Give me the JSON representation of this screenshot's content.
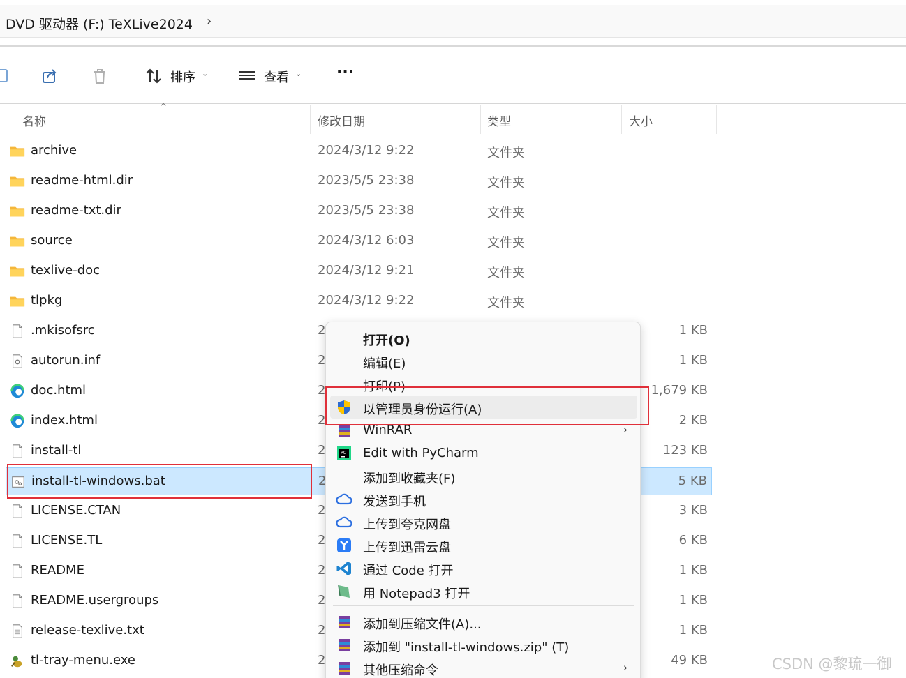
{
  "address": {
    "path": "DVD 驱动器 (F:) TeXLive2024",
    "chevron": "›"
  },
  "toolbar": {
    "sort_label": "排序",
    "view_label": "查看",
    "more_label": "···"
  },
  "columns": {
    "name": "名称",
    "date": "修改日期",
    "type": "类型",
    "size": "大小"
  },
  "files": [
    {
      "name": "archive",
      "date": "2024/3/12 9:22",
      "type": "文件夹",
      "size": "",
      "icon": "folder-icon"
    },
    {
      "name": "readme-html.dir",
      "date": "2023/5/5 23:38",
      "type": "文件夹",
      "size": "",
      "icon": "folder-icon"
    },
    {
      "name": "readme-txt.dir",
      "date": "2023/5/5 23:38",
      "type": "文件夹",
      "size": "",
      "icon": "folder-icon"
    },
    {
      "name": "source",
      "date": "2024/3/12 6:03",
      "type": "文件夹",
      "size": "",
      "icon": "folder-icon"
    },
    {
      "name": "texlive-doc",
      "date": "2024/3/12 9:21",
      "type": "文件夹",
      "size": "",
      "icon": "folder-icon"
    },
    {
      "name": "tlpkg",
      "date": "2024/3/12 9:22",
      "type": "文件夹",
      "size": "",
      "icon": "folder-icon"
    },
    {
      "name": ".mkisofsrc",
      "date": "2",
      "type": "",
      "size": "1 KB",
      "icon": "file-icon"
    },
    {
      "name": "autorun.inf",
      "date": "2",
      "type": "",
      "size": "1 KB",
      "icon": "settings-file-icon"
    },
    {
      "name": "doc.html",
      "date": "2",
      "type": "",
      "size": "1,679 KB",
      "icon": "edge-icon"
    },
    {
      "name": "index.html",
      "date": "2",
      "type": "",
      "size": "2 KB",
      "icon": "edge-icon"
    },
    {
      "name": "install-tl",
      "date": "2",
      "type": "",
      "size": "123 KB",
      "icon": "file-icon"
    },
    {
      "name": "install-tl-windows.bat",
      "date": "2",
      "type": "",
      "size": "5 KB",
      "icon": "batch-file-icon"
    },
    {
      "name": "LICENSE.CTAN",
      "date": "2",
      "type": "",
      "size": "3 KB",
      "icon": "file-icon"
    },
    {
      "name": "LICENSE.TL",
      "date": "2",
      "type": "",
      "size": "6 KB",
      "icon": "file-icon"
    },
    {
      "name": "README",
      "date": "2",
      "type": "",
      "size": "1 KB",
      "icon": "file-icon"
    },
    {
      "name": "README.usergroups",
      "date": "2",
      "type": "",
      "size": "1 KB",
      "icon": "file-icon"
    },
    {
      "name": "release-texlive.txt",
      "date": "2",
      "type": "",
      "size": "1 KB",
      "icon": "text-file-icon"
    },
    {
      "name": "tl-tray-menu.exe",
      "date": "2",
      "type": "",
      "size": "49 KB",
      "icon": "exe-icon"
    }
  ],
  "selected_file_index": 11,
  "context_menu": {
    "items": [
      {
        "label": "打开(O)",
        "bold": true,
        "icon": ""
      },
      {
        "label": "编辑(E)",
        "icon": ""
      },
      {
        "label": "打印(P)",
        "icon": ""
      },
      {
        "label": "以管理员身份运行(A)",
        "icon": "uac-shield-icon",
        "hover": true
      },
      {
        "label": "WinRAR",
        "icon": "winrar-icon",
        "submenu": true
      },
      {
        "label": "Edit with PyCharm",
        "icon": "pycharm-icon"
      },
      {
        "label": "添加到收藏夹(F)",
        "icon": ""
      },
      {
        "label": "发送到手机",
        "icon": "quark-cloud-icon"
      },
      {
        "label": "上传到夸克网盘",
        "icon": "quark-cloud-icon"
      },
      {
        "label": "上传到迅雷云盘",
        "icon": "thunder-icon"
      },
      {
        "label": "通过 Code 打开",
        "icon": "vscode-icon"
      },
      {
        "label": "用 Notepad3 打开",
        "icon": "notepad3-icon"
      },
      {
        "label": "添加到压缩文件(A)...",
        "icon": "winrar-icon",
        "separator_before": true
      },
      {
        "label": "添加到 \"install-tl-windows.zip\" (T)",
        "icon": "winrar-icon"
      },
      {
        "label": "其他压缩命令",
        "icon": "winrar-icon",
        "submenu": true
      }
    ]
  },
  "watermark": "CSDN @黎琉一御",
  "colors": {
    "selection": "#cce8ff",
    "highlight_box": "#e0303a",
    "folder": "#ffc83d"
  }
}
